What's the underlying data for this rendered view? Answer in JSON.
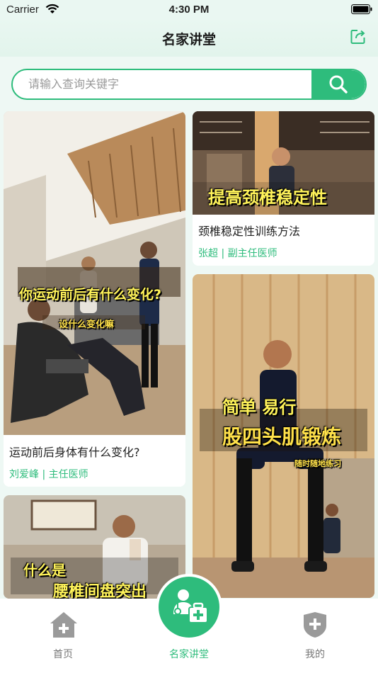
{
  "status_bar": {
    "carrier": "Carrier",
    "time": "4:30 PM"
  },
  "nav": {
    "title": "名家讲堂",
    "share_icon": "share-icon"
  },
  "search": {
    "placeholder": "请输入查询关键字",
    "value": "",
    "icon": "search-icon"
  },
  "cards": [
    {
      "title": "运动前后身体有什么变化?",
      "author": "刘爱峰 | 主任医师",
      "overlay": [
        "你运动前后有什么变化?",
        "设什么变化嘛"
      ]
    },
    {
      "title": "颈椎稳定性训练方法",
      "author": "张超 | 副主任医师",
      "overlay": [
        "提高颈椎稳定性"
      ]
    },
    {
      "title": "",
      "author": "",
      "overlay": [
        "简单 易行",
        "股四头肌锻炼",
        "随时随地练习"
      ]
    },
    {
      "title": "",
      "author": "",
      "overlay": [
        "什么是",
        "腰椎间盘突出"
      ]
    }
  ],
  "tabs": [
    {
      "label": "首页",
      "icon": "home-icon"
    },
    {
      "label": "名家讲堂",
      "icon": "doctor-kit-icon"
    },
    {
      "label": "我的",
      "icon": "shield-icon"
    }
  ],
  "colors": {
    "accent": "#2ebc7c",
    "background": "#eef8f4"
  }
}
